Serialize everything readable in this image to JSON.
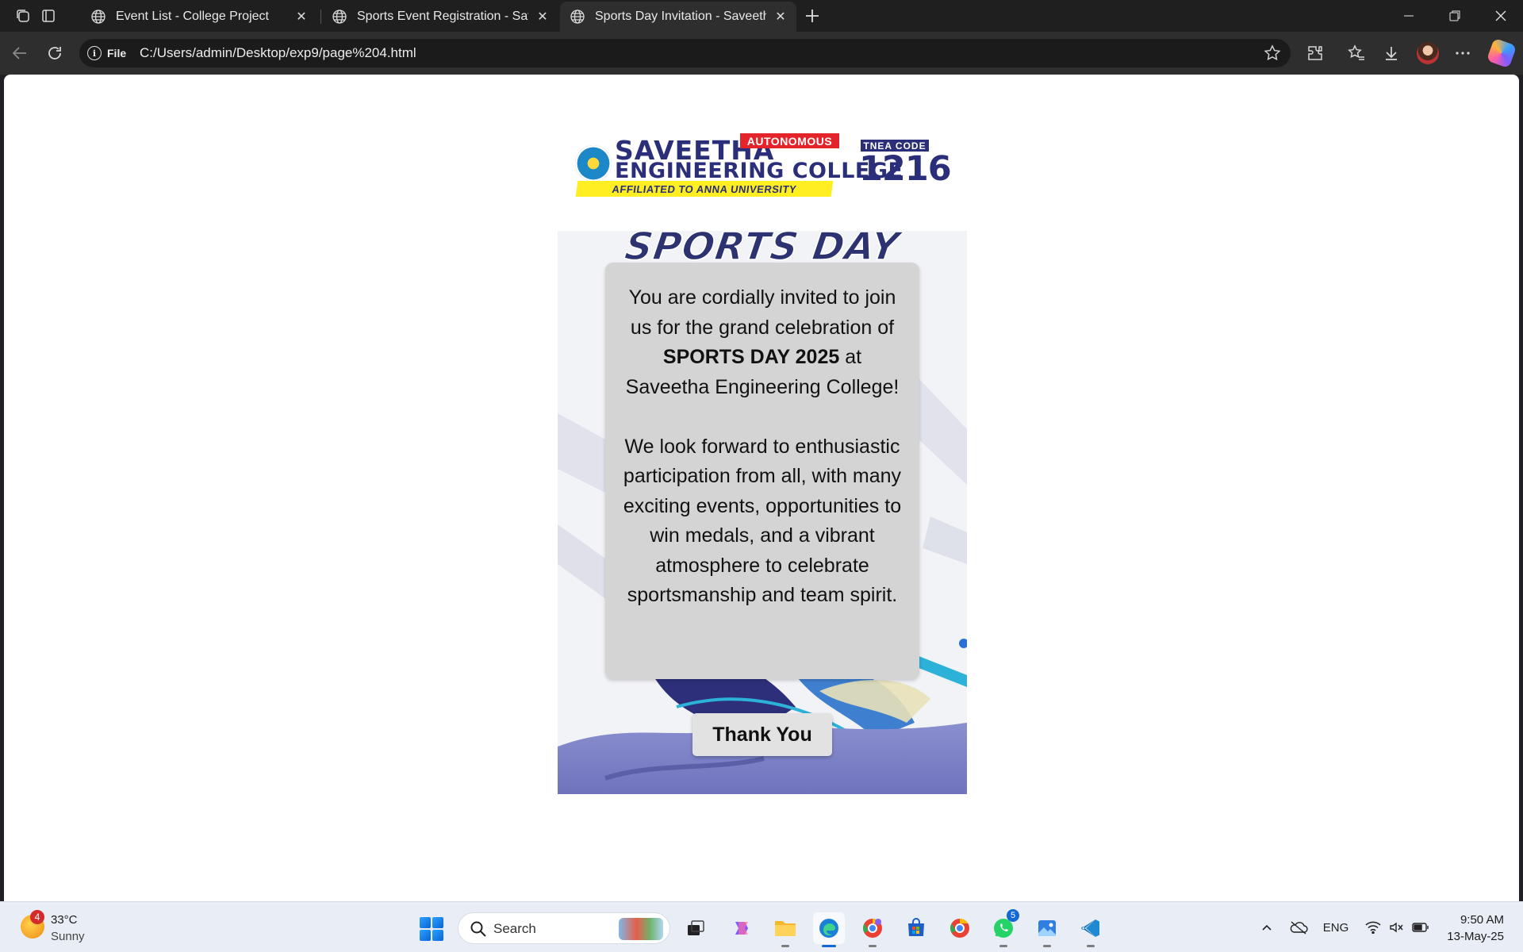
{
  "browser": {
    "tabs": [
      {
        "title": "Event List - College Project",
        "active": false
      },
      {
        "title": "Sports Event Registration - Saveetha",
        "active": false
      },
      {
        "title": "Sports Day Invitation - Saveetha E",
        "active": true
      }
    ],
    "address": {
      "scheme_label": "File",
      "url": "C:/Users/admin/Desktop/exp9/page%204.html"
    }
  },
  "page": {
    "logo": {
      "line1": "SAVEETHA",
      "line2": "ENGINEERING COLLEGE",
      "badge": "AUTONOMOUS",
      "affiliation": "AFFILIATED TO ANNA UNIVERSITY",
      "tnea_label": "TNEA CODE",
      "tnea_code": "1216"
    },
    "poster": {
      "heading": "SPORTS DAY",
      "invite_part1": "You are cordially invited to join us for the grand celebration of ",
      "invite_bold": "SPORTS DAY 2025",
      "invite_part2": " at Saveetha Engineering College!",
      "paragraph2": "We look forward to enthusiastic participation from all, with many exciting events, opportunities to win medals, and a vibrant atmosphere to celebrate sportsmanship and team spirit.",
      "button_label": "Thank You"
    }
  },
  "taskbar": {
    "weather": {
      "badge": "4",
      "temperature": "33°C",
      "condition": "Sunny"
    },
    "search_placeholder": "Search",
    "whatsapp_badge": "5",
    "language": "ENG",
    "time": "9:50 AM",
    "date": "13-May-25"
  },
  "colors": {
    "brand_navy": "#2b2f7a",
    "brand_red": "#e4242b",
    "brand_yellow": "#ffee22",
    "card_gray": "#d4d4d4",
    "edge_blue": "#1468d4"
  }
}
